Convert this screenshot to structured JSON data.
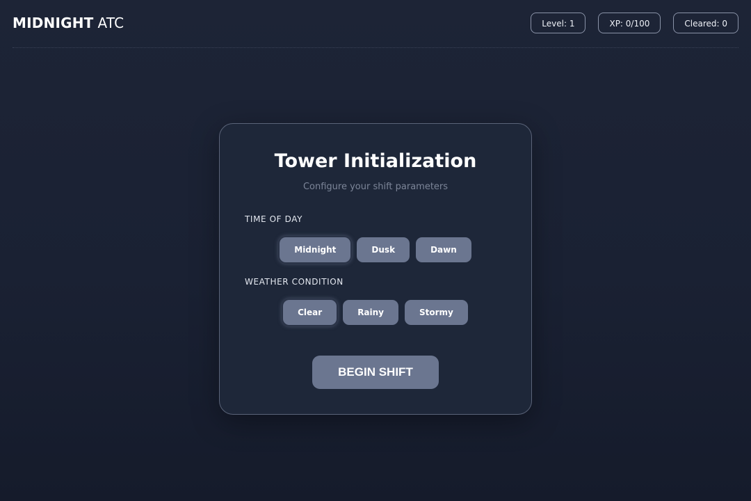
{
  "header": {
    "brand_bold": "MIDNIGHT",
    "brand_light": "ATC",
    "stats": {
      "level": "Level: 1",
      "xp": "XP: 0/100",
      "cleared": "Cleared: 0"
    }
  },
  "panel": {
    "title": "Tower Initialization",
    "subtitle": "Configure your shift parameters",
    "time_of_day": {
      "label": "TIME OF DAY",
      "options": [
        "Midnight",
        "Dusk",
        "Dawn"
      ],
      "selected": "Midnight"
    },
    "weather": {
      "label": "WEATHER CONDITION",
      "options": [
        "Clear",
        "Rainy",
        "Stormy"
      ],
      "selected": "Clear"
    },
    "begin_label": "BEGIN SHIFT"
  },
  "colors": {
    "background": "#1b2234",
    "panel": "#1e2739",
    "button": "#6b7690",
    "border": "#8a93a8"
  }
}
